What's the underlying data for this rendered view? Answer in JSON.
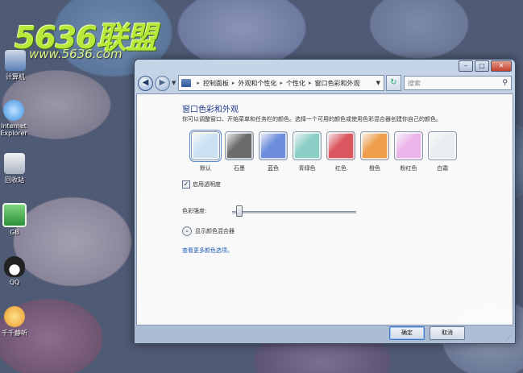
{
  "desktop": {
    "logo_text": "5636联盟",
    "logo_url": "www.5636.com",
    "icons": [
      {
        "label": "计算机",
        "color": "#5b7fb8"
      },
      {
        "label": "Internet Explorer",
        "color": "#3d8ee0"
      },
      {
        "label": "回收站",
        "color": "#c8ced8"
      },
      {
        "label": "GB",
        "color": "#3aa34a"
      },
      {
        "label": "QQ",
        "color": "#222222"
      },
      {
        "label": "千千静听",
        "color": "#e89a2a"
      }
    ]
  },
  "window": {
    "address": {
      "crumbs": [
        "控制面板",
        "外观和个性化",
        "个性化",
        "窗口色彩和外观"
      ]
    },
    "search_placeholder": "搜索",
    "title": "窗口色彩和外观",
    "description": "你可以调整窗口、开始菜单和任务栏的颜色。选择一个可用的颜色或使用色彩混合器创建你自己的颜色。",
    "swatches": [
      {
        "label": "默认",
        "color": "#cfe6f7"
      },
      {
        "label": "石墨",
        "color": "#6b6b6b"
      },
      {
        "label": "蓝色",
        "color": "#6f8fe0"
      },
      {
        "label": "青绿色",
        "color": "#8dd2c9"
      },
      {
        "label": "红色",
        "color": "#e0565e"
      },
      {
        "label": "橙色",
        "color": "#f4a04a"
      },
      {
        "label": "粉红色",
        "color": "#f1b8ee"
      },
      {
        "label": "白霜",
        "color": "#eef2f4"
      }
    ],
    "transparency_label": "启用透明度",
    "transparency_checked": true,
    "intensity_label": "色彩强度:",
    "intensity_value": 0.03,
    "mixer_label": "显示颜色混合器",
    "more_link": "查看更多颜色选项。",
    "ok_label": "确定",
    "cancel_label": "取消"
  }
}
